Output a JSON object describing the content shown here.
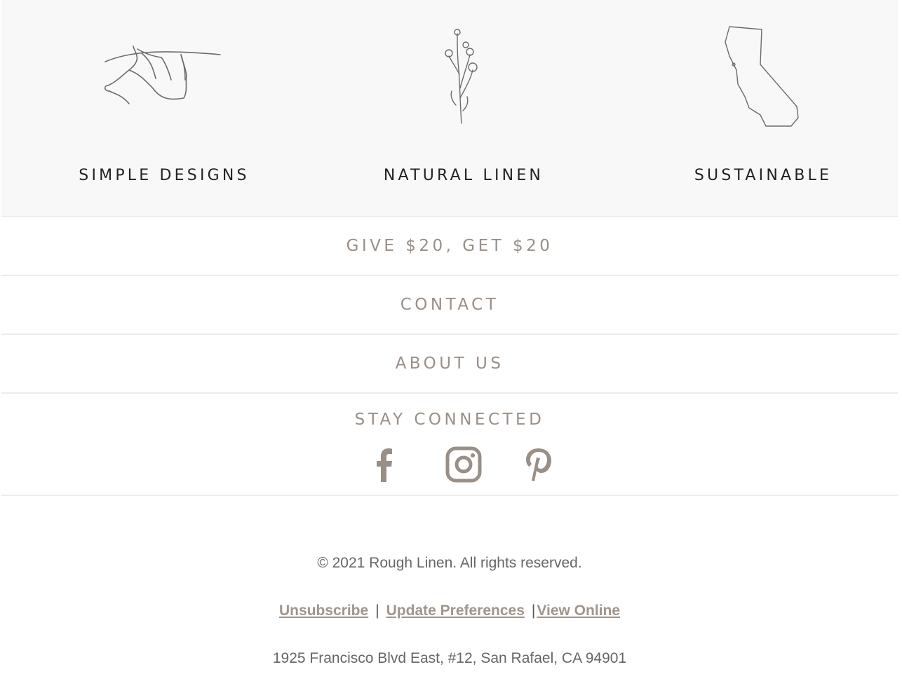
{
  "features": [
    {
      "label": "SIMPLE DESIGNS",
      "icon": "laundry-line-icon"
    },
    {
      "label": "NATURAL LINEN",
      "icon": "wildflower-icon"
    },
    {
      "label": "SUSTAINABLE",
      "icon": "california-map-icon"
    }
  ],
  "nav": {
    "give": "GIVE $20, GET $20",
    "contact": "CONTACT",
    "about": "ABOUT US"
  },
  "social": {
    "title": "STAY CONNECTED",
    "icons": [
      "facebook-icon",
      "instagram-icon",
      "pinterest-icon"
    ]
  },
  "footer": {
    "copyright": "© 2021 Rough Linen. All rights reserved.",
    "unsubscribe": "Unsubscribe",
    "separator": "|",
    "update_preferences": "Update Preferences",
    "view_online": "View Online",
    "address": "1925 Francisco Blvd East, #12, San Rafael, CA 94901"
  },
  "colors": {
    "accent": "#9a8f86",
    "feature_bg": "#f8f8f8",
    "divider": "#ececec",
    "text": "#666666"
  }
}
